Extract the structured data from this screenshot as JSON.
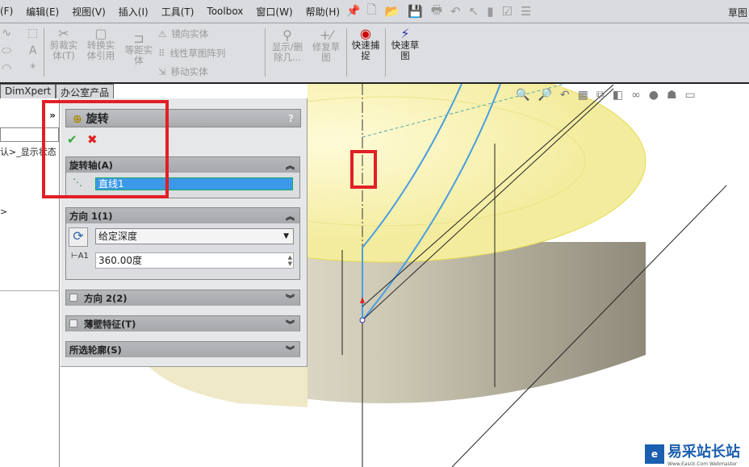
{
  "menu": {
    "items": [
      "(F)",
      "编辑(E)",
      "视图(V)",
      "插入(I)",
      "工具(T)",
      "Toolbox",
      "窗口(W)",
      "帮助(H)"
    ],
    "title_right": "草图"
  },
  "toolbar": {
    "trim": "剪裁实体(T)",
    "convert": "转换实体引用",
    "offset": "等距实体",
    "mirror": "镜向实体",
    "linear_pattern": "线性草图阵列",
    "move": "移动实体",
    "show_delete": "显示/删除几...",
    "repair": "修复草图",
    "quick_snap": "快速捕捉",
    "rapid_sketch": "快速草图"
  },
  "tabs": [
    "DimXpert",
    "办公室产品"
  ],
  "tree": {
    "text1": "认>_显示状态",
    "text2": ">",
    "expand": "»"
  },
  "pm": {
    "title": "旋转",
    "help": "?",
    "ok": "✔",
    "cancel": "✖",
    "axis": {
      "header": "旋转轴(A)",
      "value": "直线1"
    },
    "dir1": {
      "header": "方向 1(1)",
      "type": "给定深度",
      "angle": "360.00度"
    },
    "dir2": {
      "header": "方向 2(2)"
    },
    "thin": {
      "header": "薄壁特征(T)"
    },
    "contours": {
      "header": "所选轮廓(S)"
    }
  },
  "watermark": {
    "name": "易采站长站",
    "sub": "Www.Easck.Com Webmaster"
  }
}
